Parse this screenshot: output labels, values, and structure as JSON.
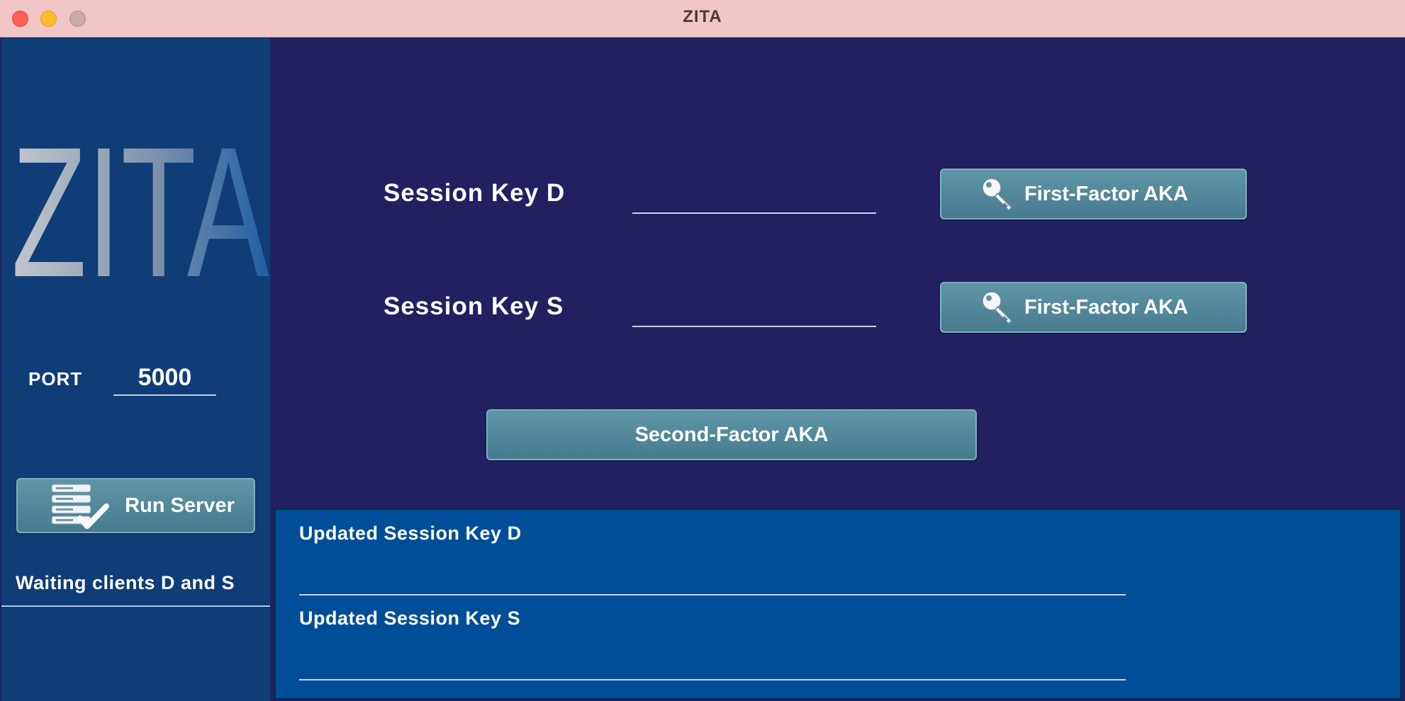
{
  "window": {
    "title": "ZITA",
    "controls": [
      "close",
      "minimize",
      "zoom"
    ]
  },
  "sidebar": {
    "logo_text": "ZITA",
    "port_label": "PORT",
    "port_value": "5000",
    "run_button_label": "Run Server",
    "run_button_icon": "server-check-icon",
    "status_text": "Waiting clients D and S"
  },
  "main": {
    "session_d": {
      "label": "Session Key D",
      "value": "",
      "button_label": "First-Factor AKA",
      "button_icon": "key-icon"
    },
    "session_s": {
      "label": "Session Key S",
      "value": "",
      "button_label": "First-Factor AKA",
      "button_icon": "key-icon"
    },
    "second_factor_button_label": "Second-Factor AKA"
  },
  "results": {
    "updated_d_label": "Updated Session Key D",
    "updated_d_value": "",
    "updated_s_label": "Updated Session Key S",
    "updated_s_value": ""
  },
  "colors": {
    "titlebar": "#f1c6c6",
    "sidebar": "#0f3d77",
    "main_background": "#222060",
    "results_background": "#004e98",
    "button": "#4f8696"
  }
}
